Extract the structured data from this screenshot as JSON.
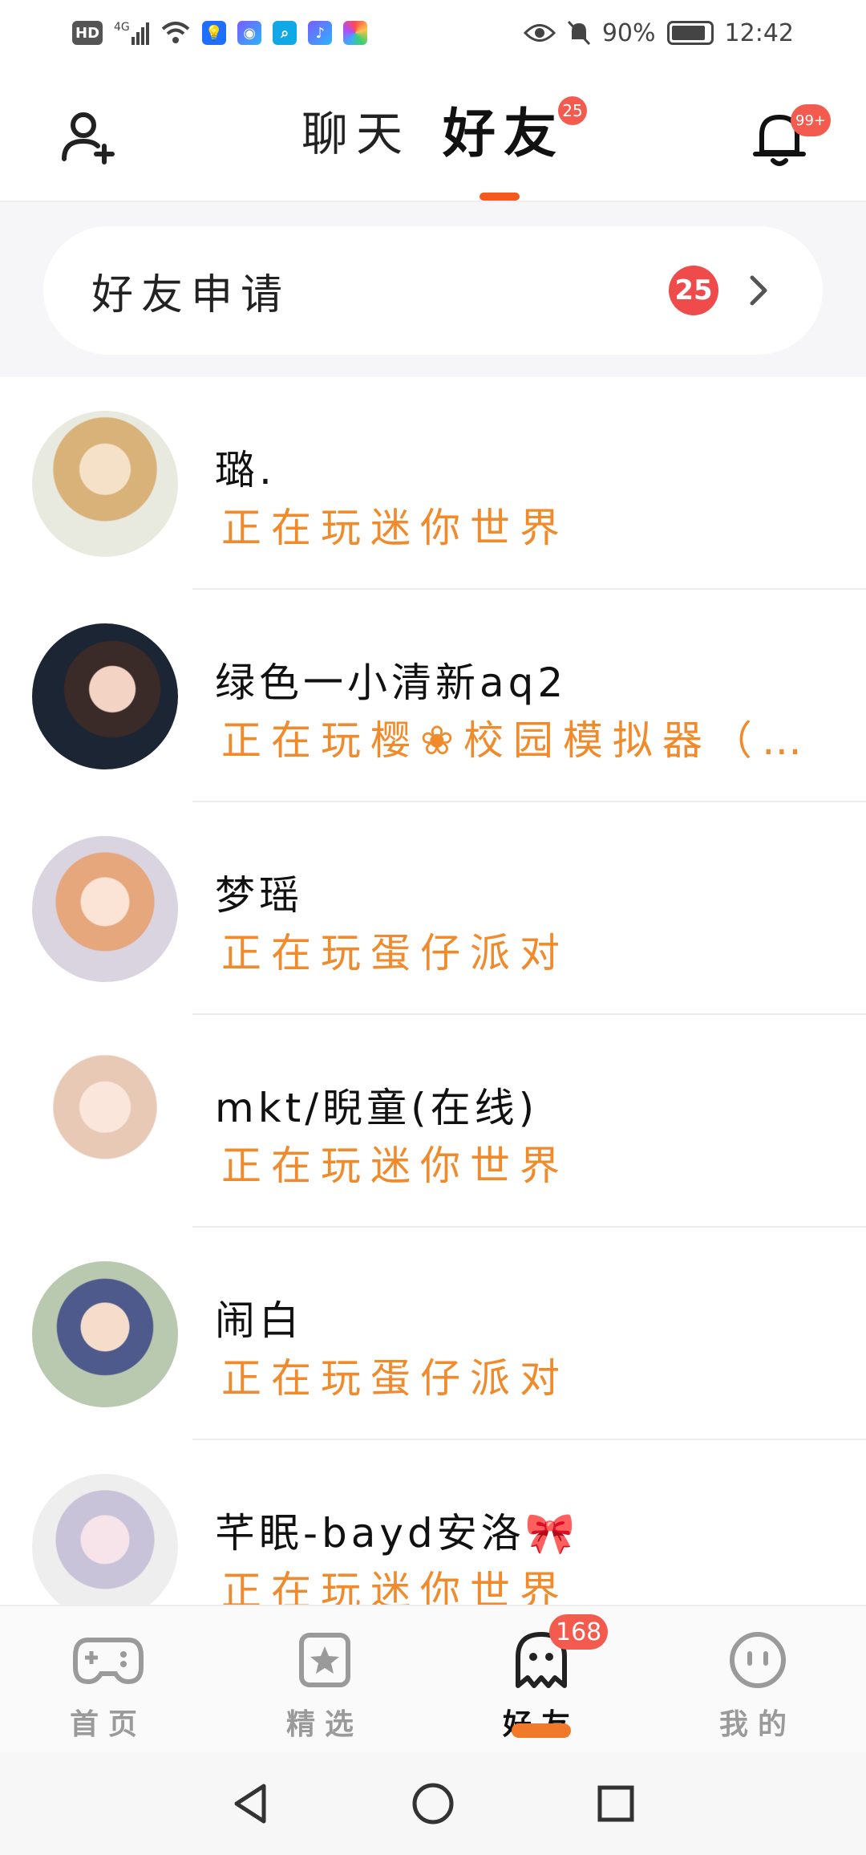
{
  "status_bar": {
    "left_icons": [
      "hd-icon",
      "signal-4g-icon",
      "wifi-icon",
      "app-notification-icon",
      "browser-icon",
      "search-app-icon",
      "music-icon",
      "app-icon"
    ],
    "hd_label": "HD",
    "network_label": "4G",
    "battery": "90%",
    "time": "12:42"
  },
  "header": {
    "tabs": [
      {
        "label": "聊天",
        "active": false,
        "badge": "25"
      },
      {
        "label": "好友",
        "active": true
      }
    ],
    "notification_badge": "99+"
  },
  "friend_request": {
    "label": "好友申请",
    "count": "25"
  },
  "friends": [
    {
      "name": "璐.",
      "status": "正在玩迷你世界"
    },
    {
      "name": "绿色一小清新aq2",
      "status": "正在玩樱❀校园模拟器（…"
    },
    {
      "name": "梦瑶",
      "status": "正在玩蛋仔派对"
    },
    {
      "name": "mkt/睨童(在线)",
      "status": "正在玩迷你世界"
    },
    {
      "name": "闹白",
      "status": "正在玩蛋仔派对"
    },
    {
      "name": "芊眠-bayd安洛🎀",
      "status": "正在玩迷你世界"
    }
  ],
  "bottom_nav": {
    "items": [
      {
        "label": "首页",
        "icon": "gamepad-icon"
      },
      {
        "label": "精选",
        "icon": "star-card-icon"
      },
      {
        "label": "好友",
        "icon": "ghost-icon",
        "badge": "168",
        "active": true
      },
      {
        "label": "我的",
        "icon": "face-icon"
      }
    ]
  },
  "colors": {
    "accent": "#f07a2a",
    "badge": "#f35b4f",
    "status_text": "#f08a2a"
  }
}
